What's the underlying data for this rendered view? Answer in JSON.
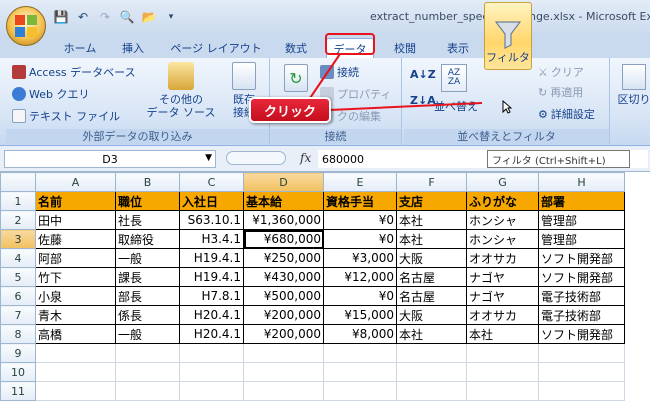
{
  "window": {
    "title": "extract_number_specified_range.xlsx - Microsoft Excel"
  },
  "ribbon_tabs": [
    {
      "label": "ホーム"
    },
    {
      "label": "挿入"
    },
    {
      "label": "ページ レイアウト"
    },
    {
      "label": "数式"
    },
    {
      "label": "データ",
      "active": true
    },
    {
      "label": "校閲"
    },
    {
      "label": "表示"
    }
  ],
  "groups": {
    "external": {
      "label": "外部データの取り込み",
      "access": "Access データベース",
      "web": "Web クエリ",
      "text": "テキスト ファイル",
      "other": "その他の\nデータ ソース",
      "other_line1": "その他の",
      "other_line2": "データ ソース",
      "existing": "既存の\n接続",
      "existing_line1": "既存",
      "existing_line2": "接続"
    },
    "connections": {
      "label": "接続",
      "connections": "接続",
      "properties": "プロパティ",
      "edit_links": "クの編集"
    },
    "sort_filter": {
      "label": "並べ替えとフィルタ",
      "sort": "並べ替え",
      "filter": "フィルタ",
      "clear": "クリア",
      "reapply": "再適用",
      "advanced": "詳細設定"
    },
    "data_tools": {
      "text_to_columns": "区切り"
    }
  },
  "callout": {
    "text": "クリック"
  },
  "tooltip": {
    "text": "フィルタ (Ctrl+Shift+L)"
  },
  "formula_bar": {
    "name_box": "D3",
    "fx": "fx",
    "value": "680000"
  },
  "sheet": {
    "columns": [
      "A",
      "B",
      "C",
      "D",
      "E",
      "F",
      "G",
      "H"
    ],
    "selected_column": "D",
    "selected_row": 3,
    "rows": [
      {
        "num": "1",
        "cells": [
          "名前",
          "職位",
          "入社日",
          "基本給",
          "資格手当",
          "支店",
          "ふりがな",
          "部署"
        ]
      },
      {
        "num": "2",
        "cells": [
          "田中",
          "社長",
          "S63.10.1",
          "¥1,360,000",
          "¥0",
          "本社",
          "ホンシャ",
          "管理部"
        ]
      },
      {
        "num": "3",
        "cells": [
          "佐藤",
          "取締役",
          "H3.4.1",
          "¥680,000",
          "¥0",
          "本社",
          "ホンシャ",
          "管理部"
        ]
      },
      {
        "num": "4",
        "cells": [
          "阿部",
          "一般",
          "H19.4.1",
          "¥250,000",
          "¥3,000",
          "大阪",
          "オオサカ",
          "ソフト開発部"
        ]
      },
      {
        "num": "5",
        "cells": [
          "竹下",
          "課長",
          "H19.4.1",
          "¥430,000",
          "¥12,000",
          "名古屋",
          "ナゴヤ",
          "ソフト開発部"
        ]
      },
      {
        "num": "6",
        "cells": [
          "小泉",
          "部長",
          "H7.8.1",
          "¥500,000",
          "¥0",
          "名古屋",
          "ナゴヤ",
          "電子技術部"
        ]
      },
      {
        "num": "7",
        "cells": [
          "青木",
          "係長",
          "H20.4.1",
          "¥200,000",
          "¥15,000",
          "大阪",
          "オオサカ",
          "電子技術部"
        ]
      },
      {
        "num": "8",
        "cells": [
          "高橋",
          "一般",
          "H20.4.1",
          "¥200,000",
          "¥8,000",
          "本社",
          "本社",
          "ソフト開発部"
        ]
      },
      {
        "num": "9",
        "cells": [
          "",
          "",
          "",
          "",
          "",
          "",
          "",
          ""
        ]
      },
      {
        "num": "10",
        "cells": [
          "",
          "",
          "",
          "",
          "",
          "",
          "",
          ""
        ]
      },
      {
        "num": "11",
        "cells": [
          "",
          "",
          "",
          "",
          "",
          "",
          "",
          ""
        ]
      }
    ]
  },
  "colors": {
    "header_fill": "#f7a800",
    "callout": "#d41324",
    "annotation_box": "#e8141c"
  }
}
